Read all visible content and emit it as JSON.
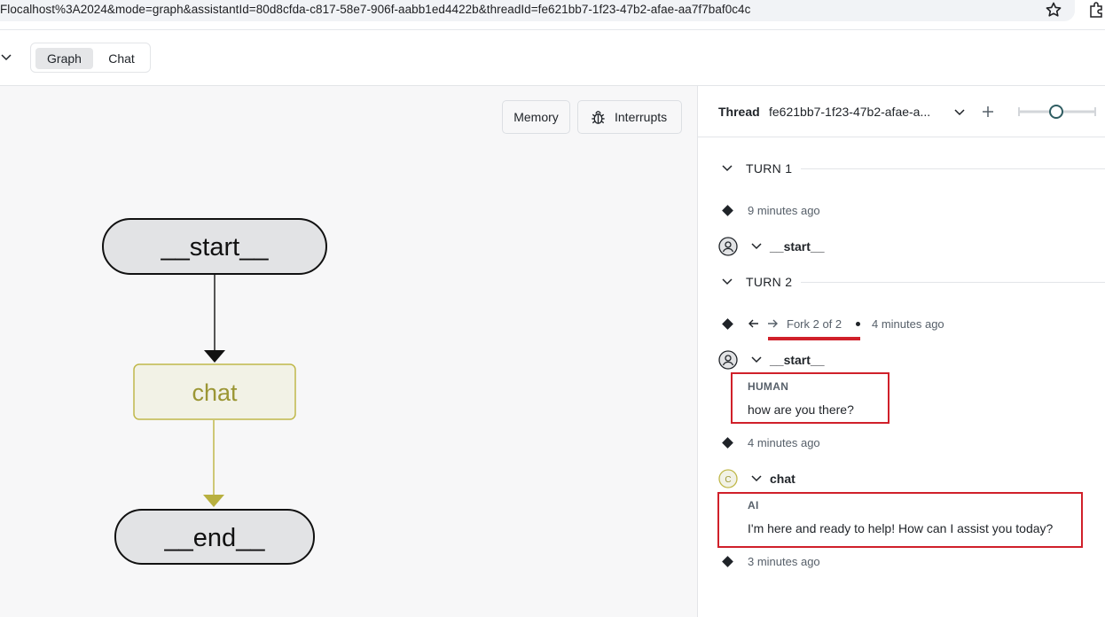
{
  "browser": {
    "url": "Flocalhost%3A2024&mode=graph&assistantId=80d8cfda-c817-58e7-906f-aabb1ed4422b&threadId=fe621bb7-1f23-47b2-afae-aa7f7baf0c4c"
  },
  "header": {
    "tabs": [
      {
        "label": "Graph",
        "active": true
      },
      {
        "label": "Chat",
        "active": false
      }
    ]
  },
  "canvas": {
    "memory_label": "Memory",
    "interrupts_label": "Interrupts",
    "nodes": {
      "start": "__start__",
      "chat": "chat",
      "end": "__end__"
    },
    "colors": {
      "node_fill": "#e2e3e5",
      "chat_fill": "#f2f2e6",
      "chat_text": "#9b9634",
      "chat_edge": "#c0b84a"
    }
  },
  "panel": {
    "thread_label": "Thread",
    "thread_id": "fe621bb7-1f23-47b2-afae-a...",
    "turns": [
      {
        "label": "TURN 1",
        "time": "9 minutes ago",
        "node": "__start__"
      },
      {
        "label": "TURN 2",
        "fork": "Fork 2 of 2",
        "time": "4 minutes ago",
        "node": "__start__"
      }
    ],
    "human": {
      "role": "HUMAN",
      "text": "how are you there?"
    },
    "after_human_time": "4 minutes ago",
    "chat_node": {
      "initial": "C",
      "name": "chat"
    },
    "ai": {
      "role": "AI",
      "text": "I'm here and ready to help! How can I assist you today?"
    },
    "after_ai_time": "3 minutes ago",
    "highlight_color": "#d0202a"
  }
}
